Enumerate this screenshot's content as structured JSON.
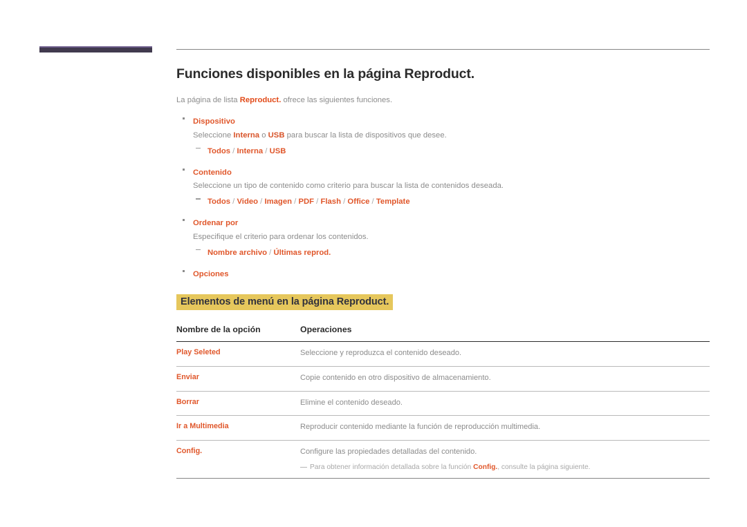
{
  "page": {
    "title": "Funciones disponibles en la página Reproduct.",
    "intro_before": "La página de lista ",
    "intro_emphasis": "Reproduct.",
    "intro_after": " ofrece las siguientes funciones."
  },
  "decoration": {
    "bar_color": "#413a4e",
    "bar_top_color": "#6b5b8a",
    "rule_color": "#858585"
  },
  "bullets": [
    {
      "label": "Dispositivo",
      "desc_parts": [
        {
          "text": "Seleccione ",
          "emphasis": false
        },
        {
          "text": "Interna",
          "emphasis": true
        },
        {
          "text": " o ",
          "emphasis": false
        },
        {
          "text": "USB",
          "emphasis": true
        },
        {
          "text": " para buscar la lista de dispositivos que desee.",
          "emphasis": false
        }
      ],
      "options": [
        "Todos",
        "Interna",
        "USB"
      ]
    },
    {
      "label": "Contenido",
      "desc_parts": [
        {
          "text": "Seleccione un tipo de contenido como criterio para buscar la lista de contenidos deseada.",
          "emphasis": false
        }
      ],
      "options": [
        "Todos",
        "Video",
        "Imagen",
        "PDF",
        "Flash",
        "Office",
        "Template"
      ]
    },
    {
      "label": "Ordenar por",
      "desc_parts": [
        {
          "text": "Especifique el criterio para ordenar los contenidos.",
          "emphasis": false
        }
      ],
      "options": [
        "Nombre archivo",
        "Últimas reprod."
      ]
    },
    {
      "label": "Opciones",
      "desc_parts": [],
      "options": []
    }
  ],
  "section": {
    "heading": "Elementos de menú en la página Reproduct.",
    "highlight_color": "#e6c75c",
    "heading_text_color": "#32323c"
  },
  "table": {
    "headers": [
      "Nombre de la opción",
      "Operaciones"
    ],
    "rows": [
      {
        "name": "Play Seleted",
        "description": "Seleccione y reproduzca el contenido deseado."
      },
      {
        "name": "Enviar",
        "description": "Copie contenido en otro dispositivo de almacenamiento."
      },
      {
        "name": "Borrar",
        "description": "Elimine el contenido deseado."
      },
      {
        "name": "Ir a Multimedia",
        "description": "Reproducir contenido mediante la función de reproducción multimedia."
      },
      {
        "name": "Config.",
        "description": "Configure las propiedades detalladas del contenido."
      }
    ],
    "note": {
      "before": "Para obtener información detallada sobre la función ",
      "emphasis": "Config.",
      "after": ", consulte la página siguiente."
    }
  },
  "colors": {
    "accent_orange": "#e0572b",
    "strong_orange": "#e24a18",
    "body_gray": "#8c8c8c",
    "title_dark": "#2b2b2b"
  }
}
